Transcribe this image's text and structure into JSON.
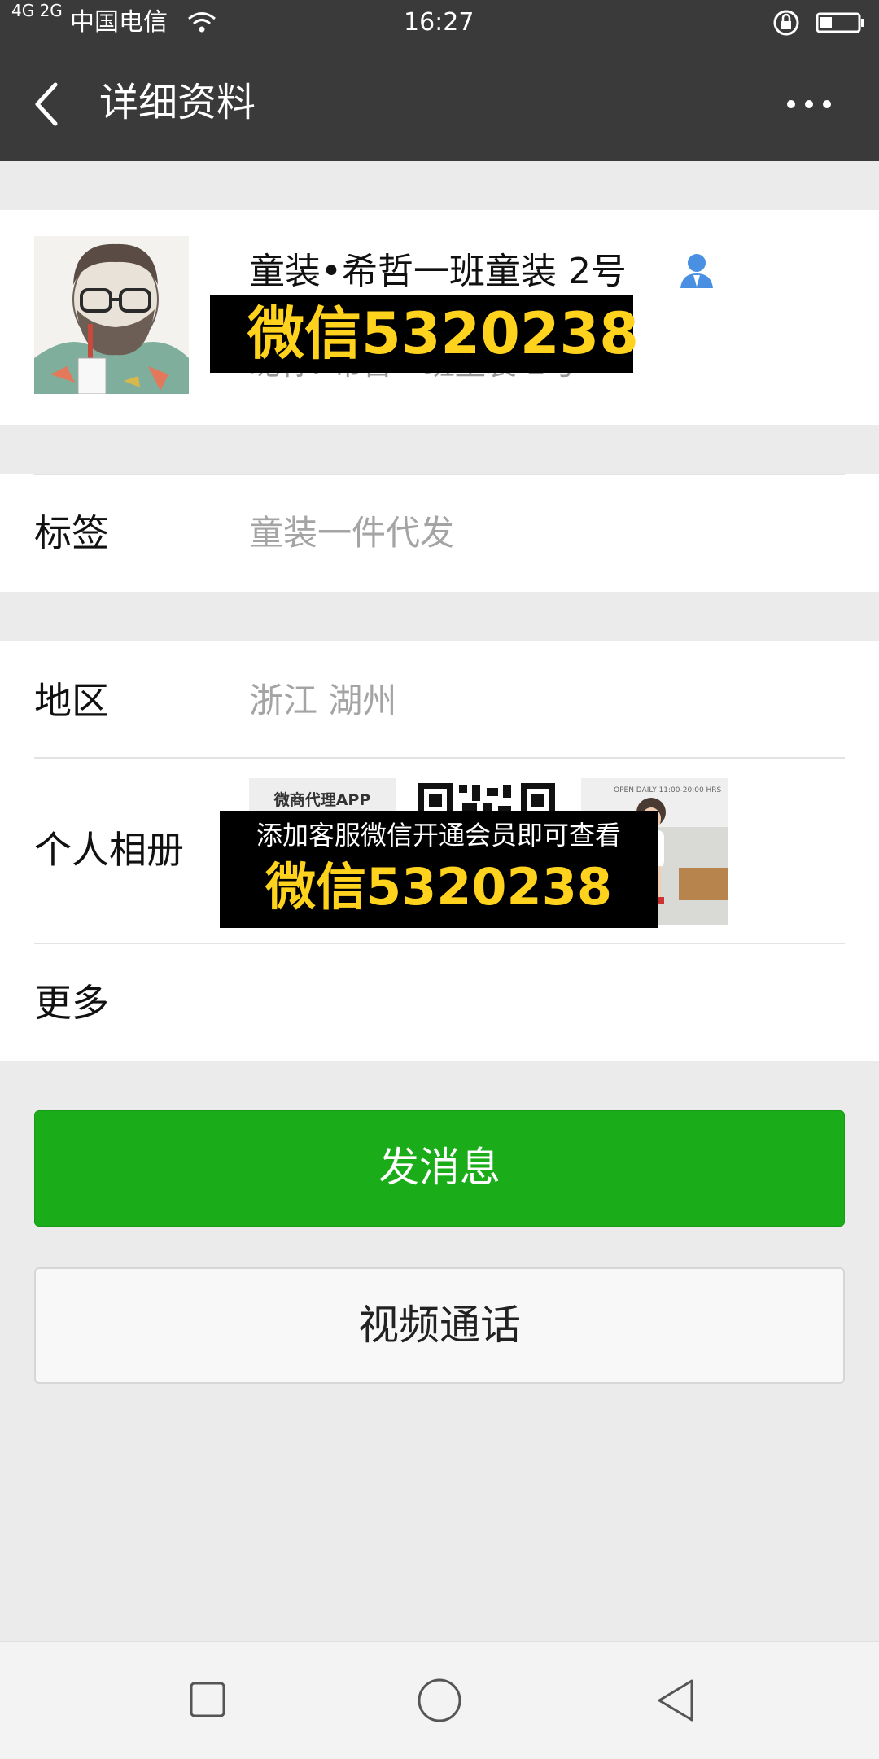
{
  "status_bar": {
    "network": "4G 2G",
    "carrier": "中国电信",
    "time": "16:27"
  },
  "header": {
    "title": "详细资料"
  },
  "profile": {
    "name": "童装•希哲一班童装  2号",
    "nickname": "昵称: 希哲一班童装  2号",
    "watermark": "微信5320238"
  },
  "rows": {
    "tags_label": "标签",
    "tags_value": "童装一件代发",
    "region_label": "地区",
    "region_value": "浙江  湖州",
    "album_label": "个人相册",
    "more_label": "更多"
  },
  "album": {
    "thumb1_text": "微商代理APP",
    "thumb3_text": "OPEN DAILY 11:00-20:00 HRS",
    "overlay_line1": "添加客服微信开通会员即可查看",
    "overlay_line2": "微信5320238"
  },
  "actions": {
    "send_message": "发消息",
    "video_call": "视频通话"
  },
  "colors": {
    "header_bg": "#3a3a3a",
    "primary_green": "#1aad19",
    "watermark_yellow": "#ffd21e",
    "contact_icon_blue": "#4a90e2"
  },
  "icons": [
    "back-arrow-icon",
    "more-icon",
    "contact-person-icon",
    "wifi-icon",
    "lock-rotation-icon",
    "battery-icon",
    "square-nav-icon",
    "circle-nav-icon",
    "triangle-back-nav-icon"
  ]
}
